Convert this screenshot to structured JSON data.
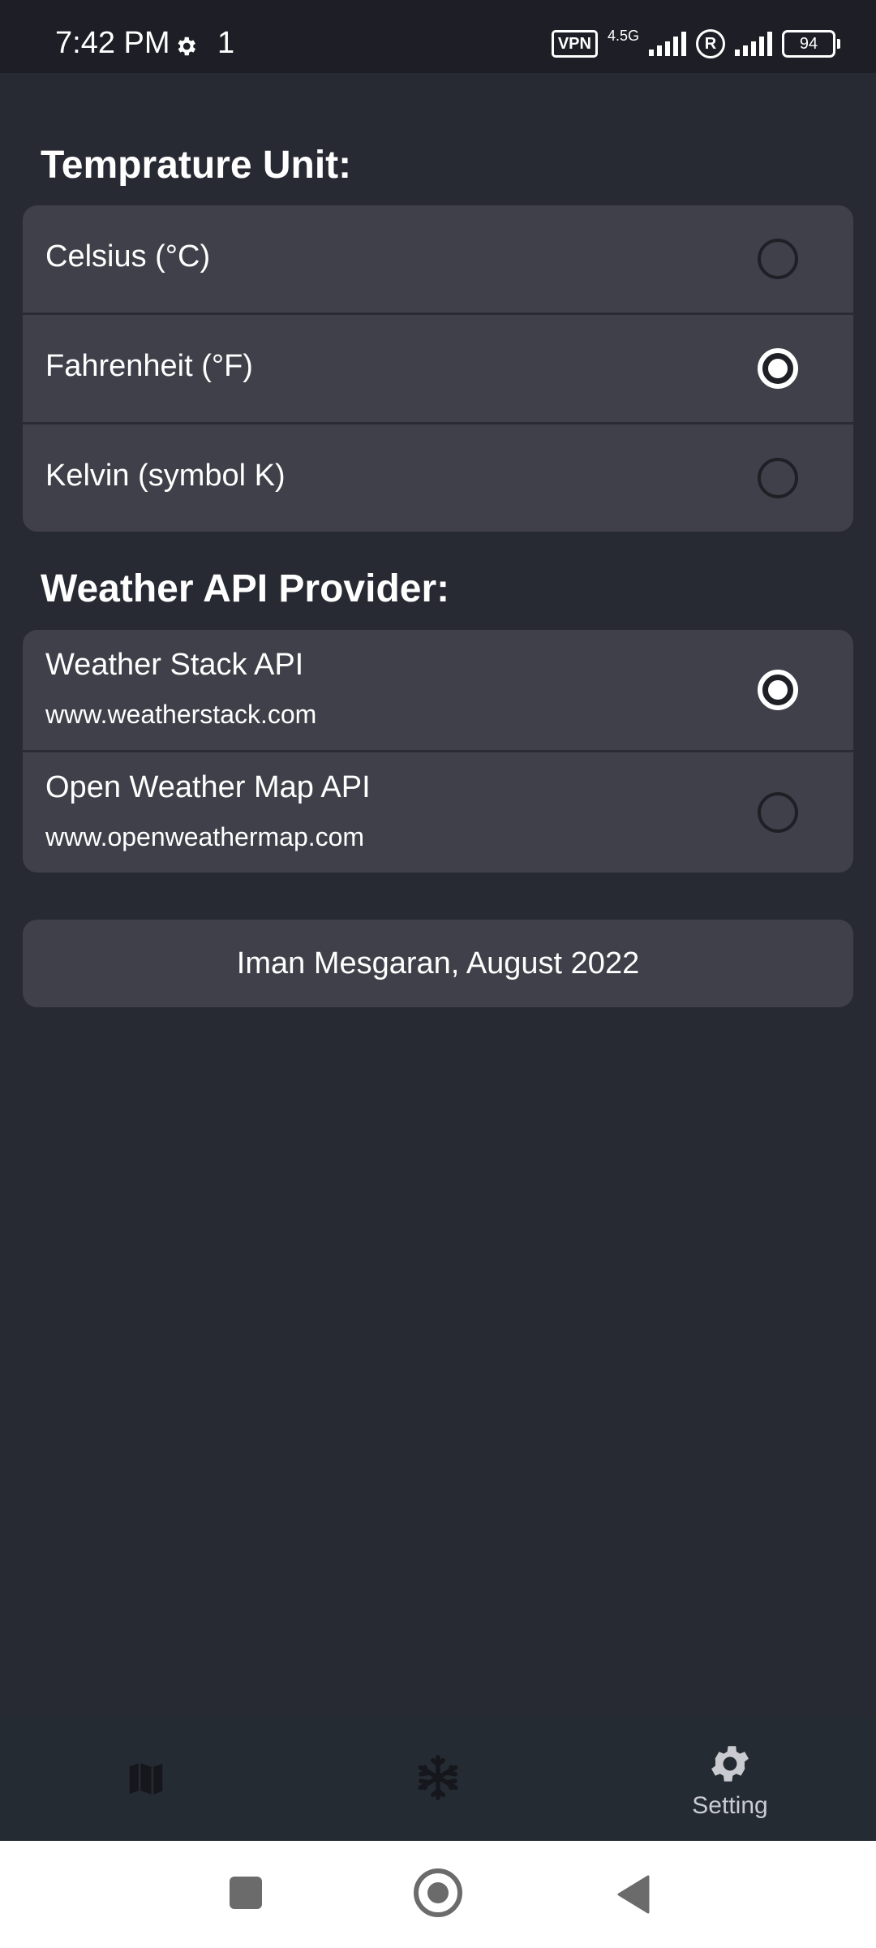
{
  "status_bar": {
    "time": "7:42 PM",
    "extra": "1",
    "vpn": "VPN",
    "network": "4.5G",
    "roaming": "R",
    "battery": "94",
    "icons": [
      "gear-icon",
      "signal-icon",
      "battery-icon"
    ]
  },
  "temperature": {
    "title": "Temprature Unit:",
    "options": [
      {
        "label": "Celsius (°C)",
        "selected": false
      },
      {
        "label": "Fahrenheit (°F)",
        "selected": true
      },
      {
        "label": "Kelvin (symbol K)",
        "selected": false
      }
    ]
  },
  "api": {
    "title": "Weather API Provider:",
    "options": [
      {
        "label": "Weather Stack API",
        "url": "www.weatherstack.com",
        "selected": true
      },
      {
        "label": "Open Weather Map API",
        "url": "www.openweathermap.com",
        "selected": false
      }
    ]
  },
  "credit": "Iman Mesgaran, August 2022",
  "bottom_nav": {
    "items": [
      {
        "icon": "map-icon",
        "label": "",
        "active": false
      },
      {
        "icon": "snowflake-icon",
        "label": "",
        "active": false
      },
      {
        "icon": "gear-icon",
        "label": "Setting",
        "active": true
      }
    ]
  },
  "system_nav": [
    "recents-square-icon",
    "home-circle-icon",
    "back-triangle-icon"
  ],
  "colors": {
    "background": "#282a33",
    "card": "#3f4049",
    "status_bar": "#1e1f26",
    "bottom_nav": "#252b32",
    "text": "#ffffff"
  }
}
